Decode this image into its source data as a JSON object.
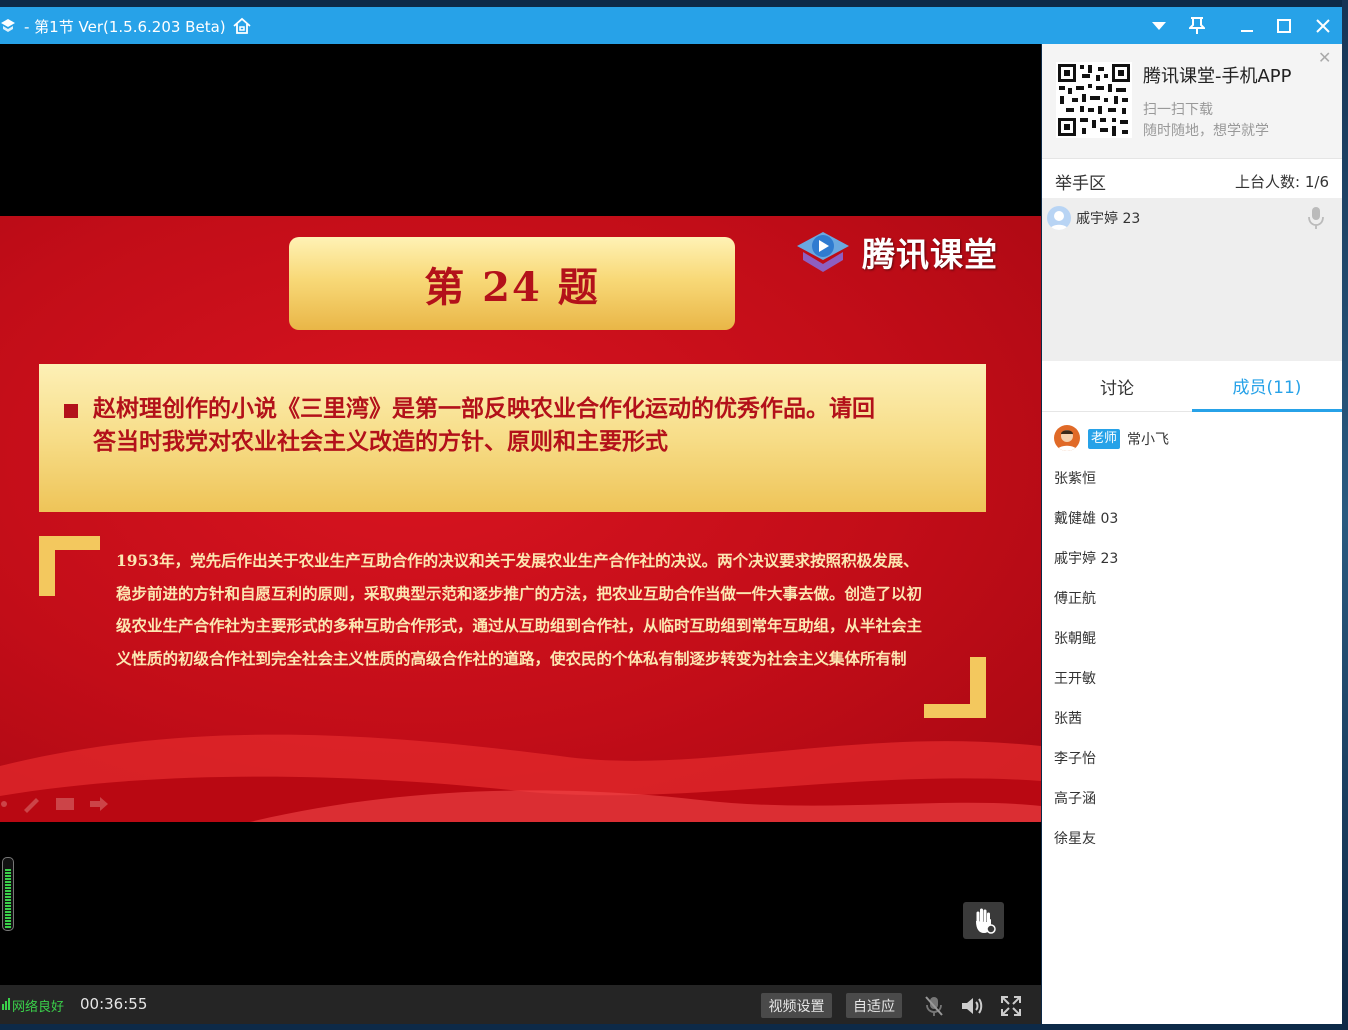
{
  "window": {
    "title": "- 第1节 Ver(1.5.6.203 Beta)"
  },
  "slide": {
    "title": "第 24 题",
    "logo_text": "腾讯课堂",
    "question": "赵树理创作的小说《三里湾》是第一部反映农业合作化运动的优秀作品。请回答当时我党对农业社会主义改造的方针、原则和主要形式",
    "answer": "1953年，党先后作出关于农业生产互助合作的决议和关于发展农业生产合作社的决议。两个决议要求按照积极发展、稳步前进的方针和自愿互利的原则，采取典型示范和逐步推广的方法，把农业互助合作当做一件大事去做。创造了以初级农业生产合作社为主要形式的多种互助合作形式，通过从互助组到合作社，从临时互助组到常年互助组，从半社会主义性质的初级合作社到完全社会主义性质的高级合作社的道路，使农民的个体私有制逐步转变为社会主义集体所有制"
  },
  "status": {
    "network": "网络良好",
    "time": "00:36:55",
    "video_settings": "视频设置",
    "fit": "自适应"
  },
  "panel": {
    "promo_title": "腾讯课堂-手机APP",
    "promo_sub1": "扫一扫下载",
    "promo_sub2": "随时随地，想学就学",
    "raise_title": "举手区",
    "raise_count": "上台人数: 1/6",
    "raise_user": "戚宇婷 23",
    "tab_discuss": "讨论",
    "tab_members": "成员(11)",
    "teacher_badge": "老师",
    "teacher_name": "常小飞",
    "members": [
      "张紫恒",
      "戴健雄 03",
      "戚宇婷 23",
      "傅正航",
      "张朝鲲",
      "王开敏",
      "张茜",
      "李子怡",
      "高子涵",
      "徐星友"
    ]
  },
  "icons": {
    "logo": "app-logo-icon",
    "home": "home-icon",
    "dropdown": "chevron-down-icon",
    "pin": "pin-icon",
    "minimize": "minimize-icon",
    "maximize": "maximize-icon",
    "close": "close-icon"
  },
  "colors": {
    "accent": "#27a2e8",
    "slide_red": "#c20d18",
    "gold": "#f8d978",
    "network_ok": "#3ad04a"
  }
}
